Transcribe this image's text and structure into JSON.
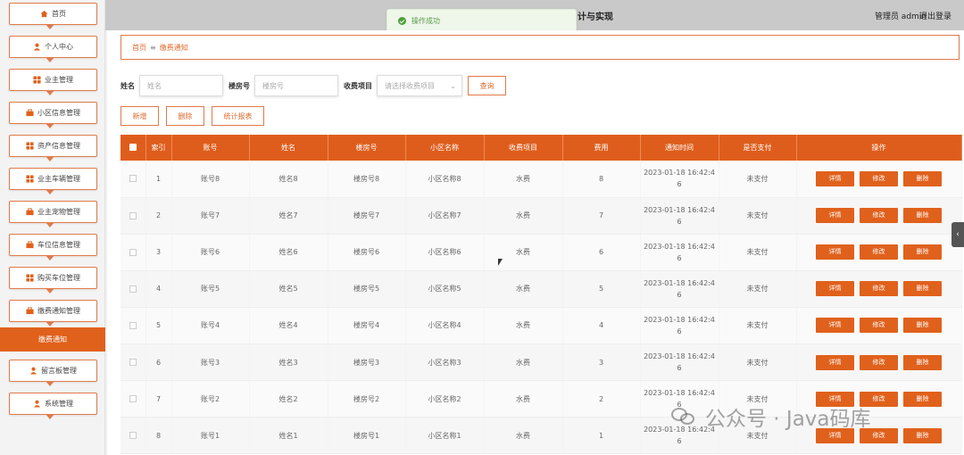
{
  "sidebar": {
    "items": [
      {
        "label": "首页",
        "icon": "home-icon"
      },
      {
        "label": "个人中心",
        "icon": "user-icon"
      },
      {
        "label": "业主管理",
        "icon": "grid-icon"
      },
      {
        "label": "小区信息管理",
        "icon": "briefcase-icon"
      },
      {
        "label": "资产信息管理",
        "icon": "grid-icon"
      },
      {
        "label": "业主车辆管理",
        "icon": "grid-icon"
      },
      {
        "label": "业主宠物管理",
        "icon": "briefcase-icon"
      },
      {
        "label": "车位信息管理",
        "icon": "briefcase-icon"
      },
      {
        "label": "购买车位管理",
        "icon": "grid-icon"
      },
      {
        "label": "缴费通知管理",
        "icon": "briefcase-icon"
      },
      {
        "label": "留言板管理",
        "icon": "user-icon"
      },
      {
        "label": "系统管理",
        "icon": "user-icon"
      }
    ],
    "active_sub": "缴费通知"
  },
  "header": {
    "title": "计与实现",
    "user": "管理员 admin",
    "logout": "退出登录"
  },
  "toast": {
    "message": "操作成功"
  },
  "breadcrumb": {
    "home": "首页",
    "sep": "≡",
    "current": "缴费通知"
  },
  "search": {
    "name_label": "姓名",
    "name_placeholder": "姓名",
    "room_label": "楼房号",
    "room_placeholder": "楼房号",
    "item_label": "收费项目",
    "item_placeholder": "请选择收费项目",
    "query_button": "查询"
  },
  "actions": {
    "add": "新增",
    "delete": "删除",
    "report": "统计报表"
  },
  "table": {
    "headers": [
      "索引",
      "账号",
      "姓名",
      "楼房号",
      "小区名称",
      "收费项目",
      "费用",
      "通知时间",
      "是否支付",
      "操作"
    ],
    "op_labels": {
      "detail": "详情",
      "edit": "修改",
      "delete": "删除"
    },
    "rows": [
      {
        "index": "1",
        "account": "账号8",
        "name": "姓名8",
        "room": "楼房号8",
        "community": "小区名称8",
        "item": "水费",
        "fee": "8",
        "time_line1": "2023-01-18 16:42:4",
        "time_line2": "6",
        "paid": "未支付"
      },
      {
        "index": "2",
        "account": "账号7",
        "name": "姓名7",
        "room": "楼房号7",
        "community": "小区名称7",
        "item": "水费",
        "fee": "7",
        "time_line1": "2023-01-18 16:42:4",
        "time_line2": "6",
        "paid": "未支付"
      },
      {
        "index": "3",
        "account": "账号6",
        "name": "姓名6",
        "room": "楼房号6",
        "community": "小区名称6",
        "item": "水费",
        "fee": "6",
        "time_line1": "2023-01-18 16:42:4",
        "time_line2": "6",
        "paid": "未支付"
      },
      {
        "index": "4",
        "account": "账号5",
        "name": "姓名5",
        "room": "楼房号5",
        "community": "小区名称5",
        "item": "水费",
        "fee": "5",
        "time_line1": "2023-01-18 16:42:4",
        "time_line2": "6",
        "paid": "未支付"
      },
      {
        "index": "5",
        "account": "账号4",
        "name": "姓名4",
        "room": "楼房号4",
        "community": "小区名称4",
        "item": "水费",
        "fee": "4",
        "time_line1": "2023-01-18 16:42:4",
        "time_line2": "6",
        "paid": "未支付"
      },
      {
        "index": "6",
        "account": "账号3",
        "name": "姓名3",
        "room": "楼房号3",
        "community": "小区名称3",
        "item": "水费",
        "fee": "3",
        "time_line1": "2023-01-18 16:42:4",
        "time_line2": "6",
        "paid": "未支付"
      },
      {
        "index": "7",
        "account": "账号2",
        "name": "姓名2",
        "room": "楼房号2",
        "community": "小区名称2",
        "item": "水费",
        "fee": "2",
        "time_line1": "2023-01-18 16:42:4",
        "time_line2": "6",
        "paid": "未支付"
      },
      {
        "index": "8",
        "account": "账号1",
        "name": "姓名1",
        "room": "楼房号1",
        "community": "小区名称1",
        "item": "水费",
        "fee": "1",
        "time_line1": "2023-01-18 16:42:4",
        "time_line2": "6",
        "paid": "未支付"
      }
    ]
  },
  "watermark": "公众号 · Java码库",
  "colors": {
    "accent": "#e0611c",
    "accent_border": "#e07a4a",
    "success": "#4ea03a"
  }
}
